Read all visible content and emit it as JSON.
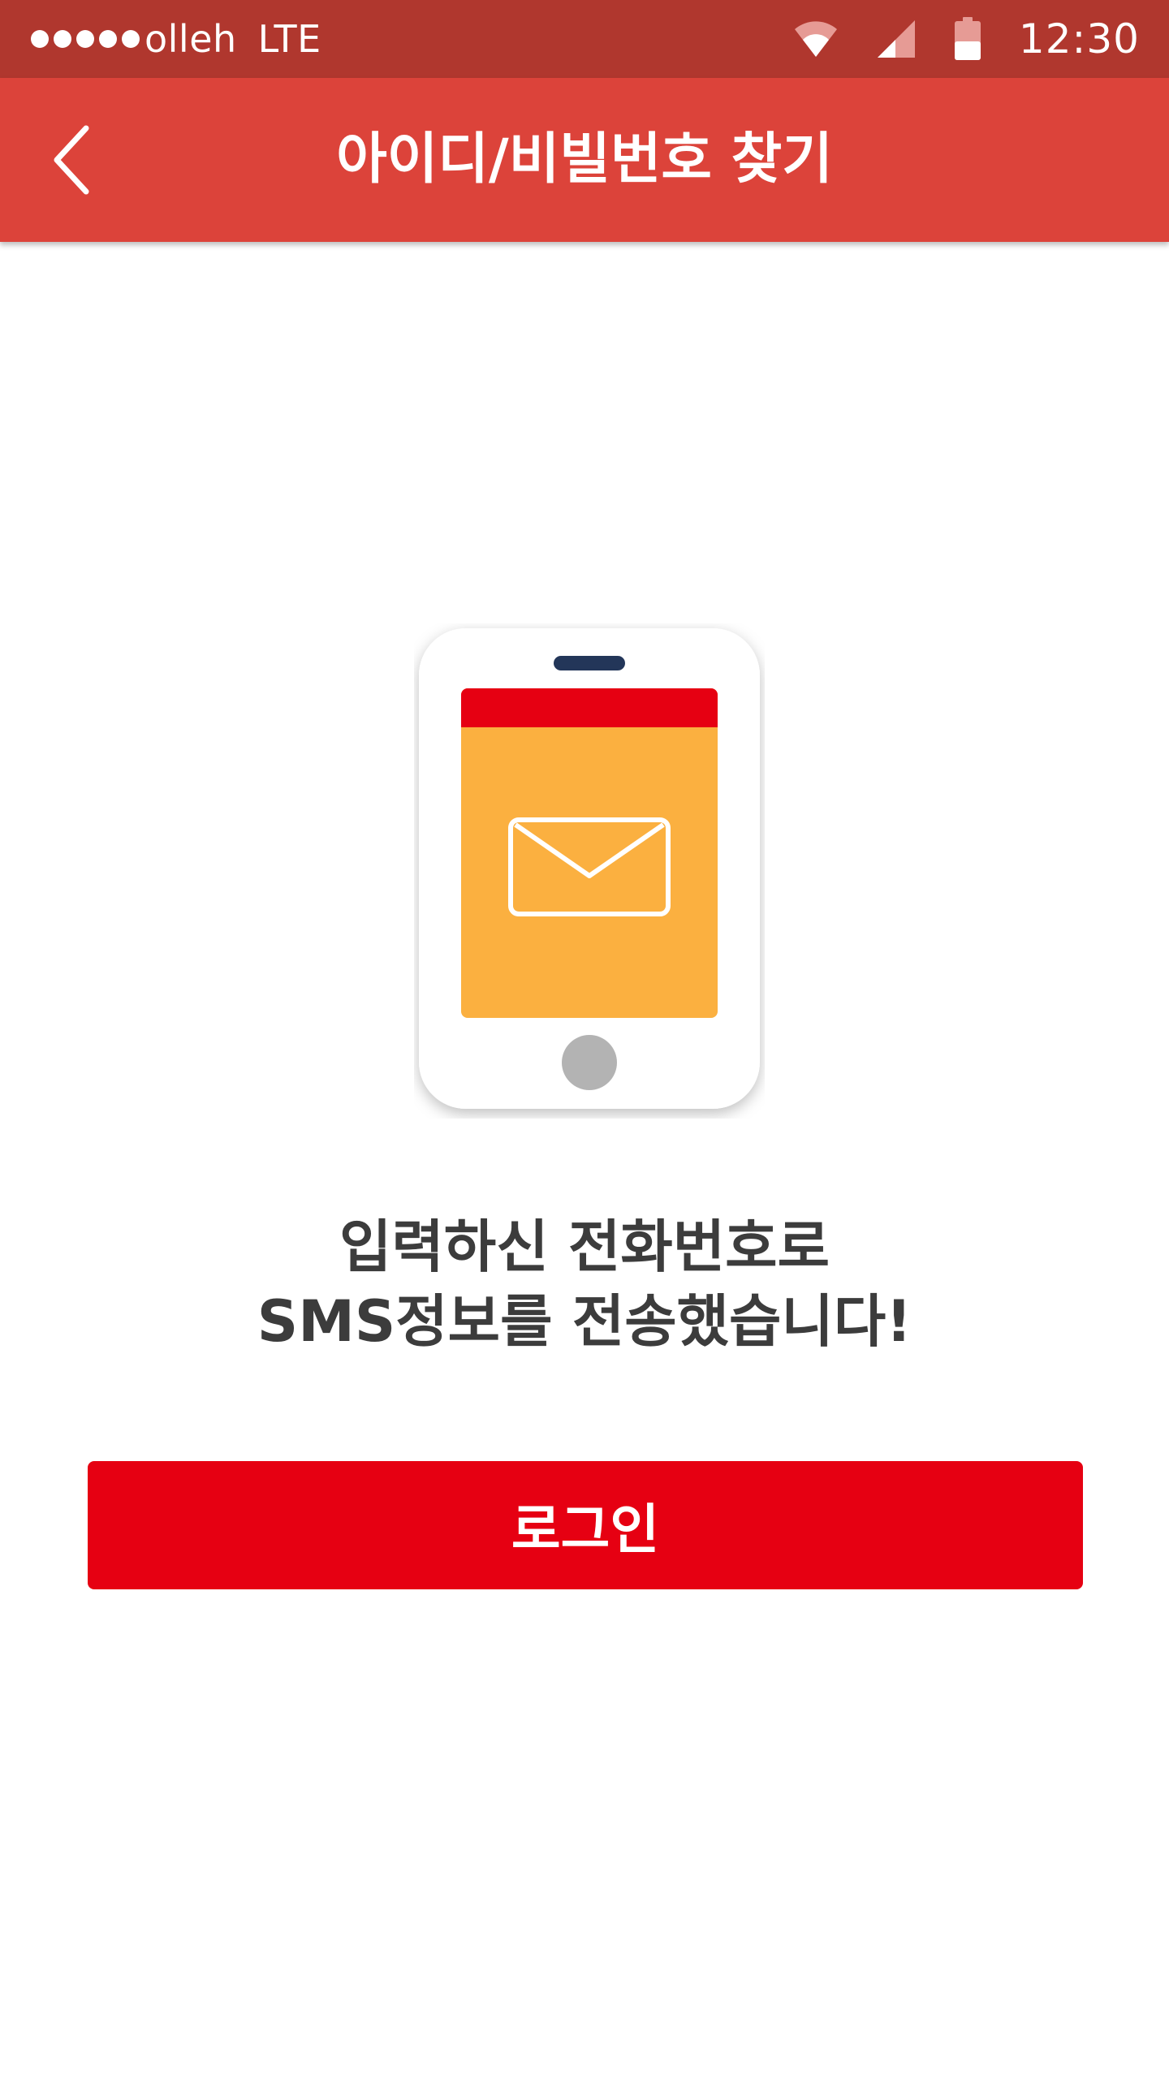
{
  "status_bar": {
    "carrier": "olleh",
    "network": "LTE",
    "time": "12:30",
    "icons": [
      "signal-dots-icon",
      "wifi-icon",
      "cellular-signal-icon",
      "battery-icon"
    ]
  },
  "app_bar": {
    "title": "아이디/비빌번호 찾기",
    "back_icon": "chevron-left-icon"
  },
  "illustration": {
    "icon": "phone-mail-illustration",
    "colors": {
      "phone_body": "#ffffff",
      "screen": "#fbb040",
      "screen_header": "#e60012",
      "speaker": "#233659",
      "home_button": "#b3b3b3"
    }
  },
  "message": {
    "line1": "입력하신 전화번호로",
    "line2": "SMS정보를 전송했습니다!"
  },
  "login_button": {
    "label": "로그인"
  },
  "colors": {
    "status_bar": "#b0372e",
    "app_bar": "#dc433a",
    "primary_button": "#e60012",
    "message_text": "#3c3c3c"
  }
}
